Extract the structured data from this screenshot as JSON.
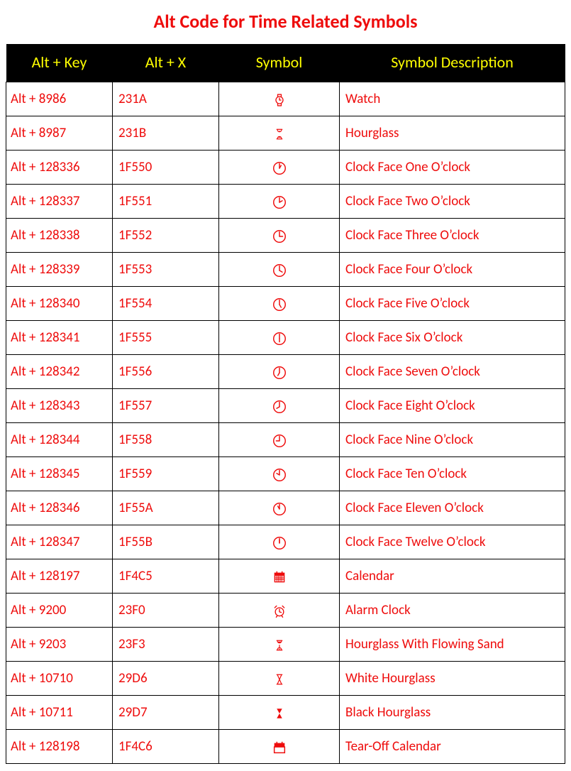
{
  "title": "Alt Code for Time Related Symbols",
  "columns": [
    "Alt + Key",
    "Alt + X",
    "Symbol",
    "Symbol Description"
  ],
  "rows": [
    {
      "alt_key": "Alt + 8986",
      "alt_x": "231A",
      "symbol": "watch",
      "desc": "Watch"
    },
    {
      "alt_key": "Alt + 8987",
      "alt_x": "231B",
      "symbol": "hourglass",
      "desc": "Hourglass"
    },
    {
      "alt_key": "Alt + 128336",
      "alt_x": "1F550",
      "symbol": "clock1",
      "desc": "Clock Face One O’clock"
    },
    {
      "alt_key": "Alt + 128337",
      "alt_x": "1F551",
      "symbol": "clock2",
      "desc": "Clock Face Two O’clock"
    },
    {
      "alt_key": "Alt + 128338",
      "alt_x": "1F552",
      "symbol": "clock3",
      "desc": "Clock Face Three O’clock"
    },
    {
      "alt_key": "Alt + 128339",
      "alt_x": "1F553",
      "symbol": "clock4",
      "desc": "Clock Face Four O’clock"
    },
    {
      "alt_key": "Alt + 128340",
      "alt_x": "1F554",
      "symbol": "clock5",
      "desc": "Clock Face Five O’clock"
    },
    {
      "alt_key": "Alt + 128341",
      "alt_x": "1F555",
      "symbol": "clock6",
      "desc": "Clock Face Six O’clock"
    },
    {
      "alt_key": "Alt + 128342",
      "alt_x": "1F556",
      "symbol": "clock7",
      "desc": "Clock Face Seven O’clock"
    },
    {
      "alt_key": "Alt + 128343",
      "alt_x": "1F557",
      "symbol": "clock8",
      "desc": "Clock Face Eight O’clock"
    },
    {
      "alt_key": "Alt + 128344",
      "alt_x": "1F558",
      "symbol": "clock9",
      "desc": "Clock Face Nine O’clock"
    },
    {
      "alt_key": "Alt + 128345",
      "alt_x": "1F559",
      "symbol": "clock10",
      "desc": "Clock Face Ten O’clock"
    },
    {
      "alt_key": "Alt + 128346",
      "alt_x": "1F55A",
      "symbol": "clock11",
      "desc": "Clock Face Eleven O’clock"
    },
    {
      "alt_key": "Alt + 128347",
      "alt_x": "1F55B",
      "symbol": "clock12",
      "desc": "Clock Face Twelve O’clock"
    },
    {
      "alt_key": "Alt + 128197",
      "alt_x": "1F4C5",
      "symbol": "calendar",
      "desc": "Calendar"
    },
    {
      "alt_key": "Alt + 9200",
      "alt_x": "23F0",
      "symbol": "alarm",
      "desc": "Alarm Clock"
    },
    {
      "alt_key": "Alt + 9203",
      "alt_x": "23F3",
      "symbol": "hourglass-flow",
      "desc": "Hourglass With Flowing Sand"
    },
    {
      "alt_key": "Alt + 10710",
      "alt_x": "29D6",
      "symbol": "white-hourglass",
      "desc": "White Hourglass"
    },
    {
      "alt_key": "Alt + 10711",
      "alt_x": "29D7",
      "symbol": "black-hourglass",
      "desc": "Black Hourglass"
    },
    {
      "alt_key": "Alt + 128198",
      "alt_x": "1F4C6",
      "symbol": "tearoff-calendar",
      "desc": "Tear-Off Calendar"
    }
  ]
}
